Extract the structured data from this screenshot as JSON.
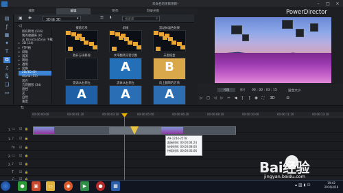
{
  "app": {
    "title": "未命名的项目项目*",
    "brand": "PowerDirector"
  },
  "tabs": [
    "捕获",
    "编辑",
    "制作",
    "刻录光盘"
  ],
  "toolbar": {
    "filter": "3D/非 3D",
    "search_placeholder": "搜索库"
  },
  "categories": [
    "所有转场 (116)",
    "我的收藏夹 (0)",
    "从 DirectorZone 下载",
    "3D (24)",
    "打开格",
    "斜角",
    "涡流",
    "转场",
    "透明",
    "变换",
    "2D/3D (6)",
    "Alpha (55)",
    "混合",
    "几何图形 (34)",
    "遮挡",
    "光",
    "自然",
    "速度"
  ],
  "category_arrows": [
    "",
    "",
    "",
    "▸",
    "▸",
    "▸",
    "▸",
    "▸",
    "▸",
    "▸",
    "",
    "",
    "",
    "",
    "",
    "",
    "",
    ""
  ],
  "transitions": [
    {
      "caption": "擦除方块",
      "label": ""
    },
    {
      "caption": "斜线",
      "label": ""
    },
    {
      "caption": "流动体滤色效果",
      "label": ""
    },
    {
      "caption": "散开方块移除",
      "label": ""
    },
    {
      "caption": "水平翻转交错切割",
      "label": "A"
    },
    {
      "caption": "天窗纸盒",
      "label": "B"
    },
    {
      "caption": "旋涡从右到左",
      "label": "A"
    },
    {
      "caption": "流体从右到左",
      "label": "A"
    },
    {
      "caption": "向上翻转的方块",
      "label": "A"
    }
  ],
  "preview": {
    "tabs": [
      "片段",
      "影片"
    ],
    "timecode": "00 : 00 : 03 : 15",
    "zoom": "适合大小"
  },
  "ruler": [
    "00:00:00:00",
    "00:00:01:20",
    "00:00:03:10",
    "00:00:05:00",
    "00:00:06:20",
    "00:00:08:10",
    "00:00:10:00",
    "00:00:11:20",
    "00:00:13:10"
  ],
  "tracks": [
    {
      "num": "1.",
      "icon": "▭",
      "label": "视频"
    },
    {
      "num": "1.",
      "icon": "♪",
      "label": "音频"
    },
    {
      "num": "",
      "icon": "fx",
      "label": ""
    },
    {
      "num": "2.",
      "icon": "▭",
      "label": "视频"
    },
    {
      "num": "2.",
      "icon": "♪",
      "label": "音频"
    },
    {
      "num": "",
      "icon": "T",
      "label": ""
    },
    {
      "num": "",
      "icon": "♫",
      "label": ""
    }
  ],
  "clips": {
    "left": "clip1",
    "right": "clip2"
  },
  "tooltip": {
    "title": "A9-1244-2578",
    "start": "起始时间: 00:00:04:24",
    "end": "结束时间: 00:00:08:00",
    "dur": "持续时间: 00:00:03:06"
  },
  "taskbar": {
    "time": "19:42",
    "date": "2016/4/16"
  },
  "watermark": {
    "brand": "Bai经验",
    "url": "jingyan.baidu.com"
  },
  "colors": {
    "accent": "#3b84d6",
    "playhead": "#e04040"
  }
}
